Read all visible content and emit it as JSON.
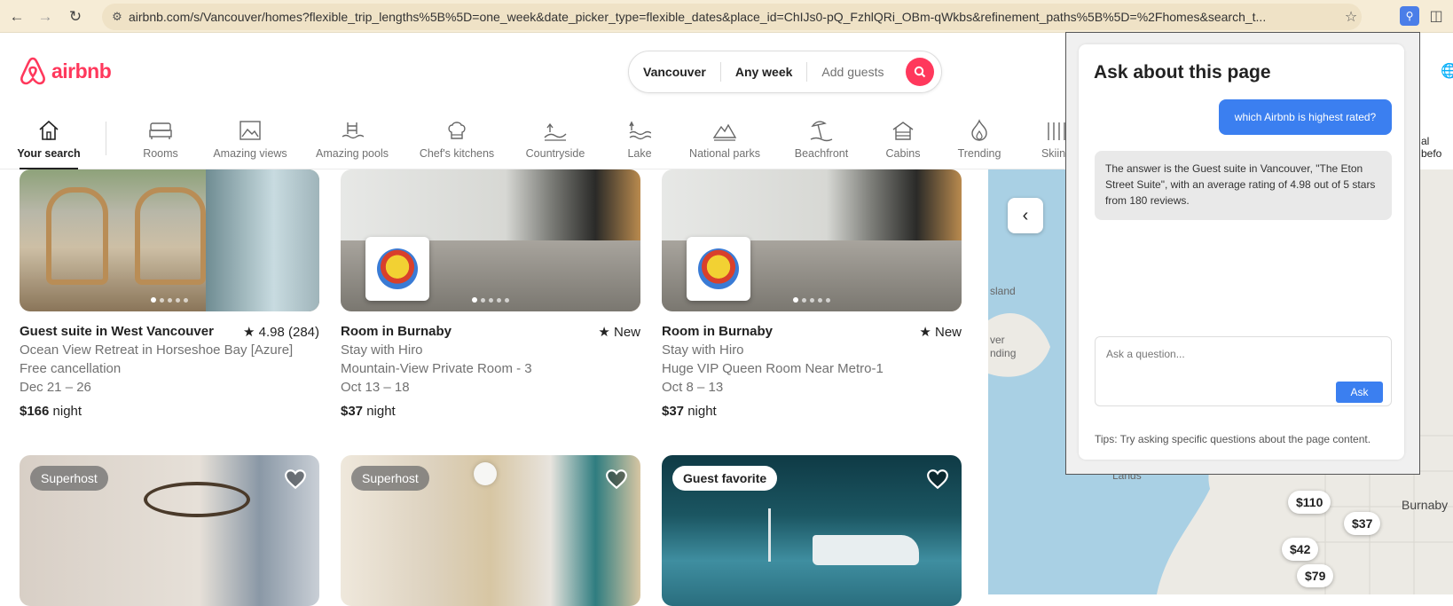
{
  "browser": {
    "url": "airbnb.com/s/Vancouver/homes?flexible_trip_lengths%5B%5D=one_week&date_picker_type=flexible_dates&place_id=ChIJs0-pQ_FzhlQRi_OBm-qWkbs&refinement_paths%5B%5D=%2Fhomes&search_t..."
  },
  "header": {
    "logo_text": "airbnb",
    "search": {
      "location": "Vancouver",
      "dates": "Any week",
      "guests": "Add guests"
    }
  },
  "categories": [
    {
      "label": "Your search",
      "icon": "house-icon",
      "active": true
    },
    {
      "label": "Rooms",
      "icon": "bed-icon"
    },
    {
      "label": "Amazing views",
      "icon": "picture-frame-icon"
    },
    {
      "label": "Amazing pools",
      "icon": "pool-icon"
    },
    {
      "label": "Chef's kitchens",
      "icon": "chef-hat-icon"
    },
    {
      "label": "Countryside",
      "icon": "countryside-icon"
    },
    {
      "label": "Lake",
      "icon": "lake-icon"
    },
    {
      "label": "National parks",
      "icon": "national-park-icon"
    },
    {
      "label": "Beachfront",
      "icon": "beach-icon"
    },
    {
      "label": "Cabins",
      "icon": "cabin-icon"
    },
    {
      "label": "Trending",
      "icon": "flame-icon"
    },
    {
      "label": "Skiing",
      "icon": "ski-icon"
    }
  ],
  "categories_overflow_text": "al befo",
  "listings": [
    {
      "title": "Guest suite in West Vancouver",
      "rating": "★ 4.98 (284)",
      "line1": "Ocean View Retreat in Horseshoe Bay [Azure]",
      "line2": "Free cancellation",
      "dates": "Dec 21 – 26",
      "price": "$166",
      "price_unit": " night"
    },
    {
      "title": "Room in Burnaby",
      "rating": "★ New",
      "line1": "Stay with Hiro",
      "line2": "Mountain-View Private Room - 3",
      "dates": "Oct 13 – 18",
      "price": "$37",
      "price_unit": " night"
    },
    {
      "title": "Room in Burnaby",
      "rating": "★ New",
      "line1": "Stay with Hiro",
      "line2": "Huge VIP Queen Room Near Metro-1",
      "dates": "Oct 8 – 13",
      "price": "$37",
      "price_unit": " night"
    }
  ],
  "badges": [
    "Superhost",
    "Superhost",
    "Guest favorite"
  ],
  "map": {
    "pins": [
      "$110",
      "$37",
      "$42",
      "$79"
    ],
    "labels": [
      "sland",
      "ver",
      "nding",
      "Lands",
      "Burnaby"
    ]
  },
  "panel": {
    "title": "Ask about this page",
    "user_message": "which Airbnb is highest rated?",
    "ai_message": "The answer is the Guest suite in Vancouver, \"The Eton Street Suite\", with an average rating of 4.98 out of 5 stars from 180 reviews.",
    "input_placeholder": "Ask a question...",
    "ask_button": "Ask",
    "tips": "Tips: Try asking specific questions about the page content."
  }
}
